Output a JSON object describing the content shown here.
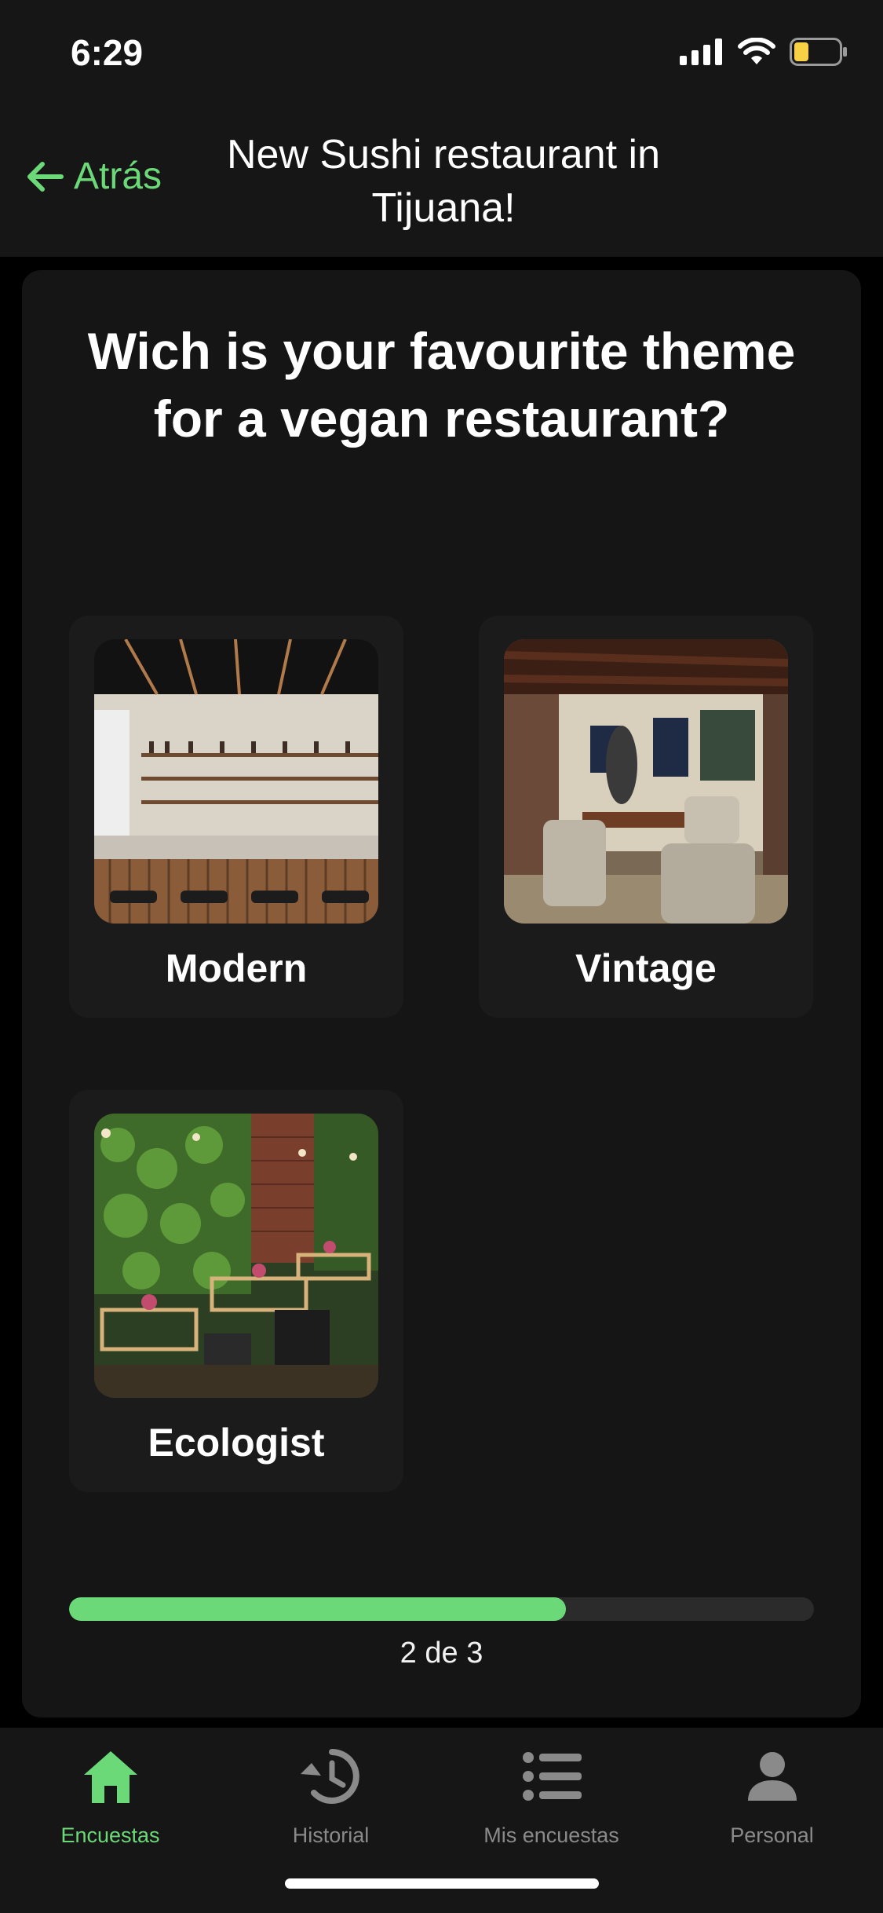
{
  "status_bar": {
    "time": "6:29"
  },
  "nav": {
    "back_label": "Atrás",
    "title": "New Sushi restaurant in Tijuana!"
  },
  "question": "Wich is your favourite theme for a vegan restaurant?",
  "options": [
    {
      "label": "Modern",
      "image": "modern-restaurant-bar-photo"
    },
    {
      "label": "Vintage",
      "image": "vintage-restaurant-interior-photo"
    },
    {
      "label": "Ecologist",
      "image": "green-wall-restaurant-photo"
    }
  ],
  "progress": {
    "current": 2,
    "total": 3,
    "text": "2 de 3"
  },
  "tabs": [
    {
      "label": "Encuestas",
      "icon": "home-icon",
      "active": true
    },
    {
      "label": "Historial",
      "icon": "history-icon",
      "active": false
    },
    {
      "label": "Mis encuestas",
      "icon": "list-icon",
      "active": false
    },
    {
      "label": "Personal",
      "icon": "person-icon",
      "active": false
    }
  ],
  "colors": {
    "accent": "#6cd979",
    "background": "#151515",
    "surface": "#1b1b1b"
  }
}
